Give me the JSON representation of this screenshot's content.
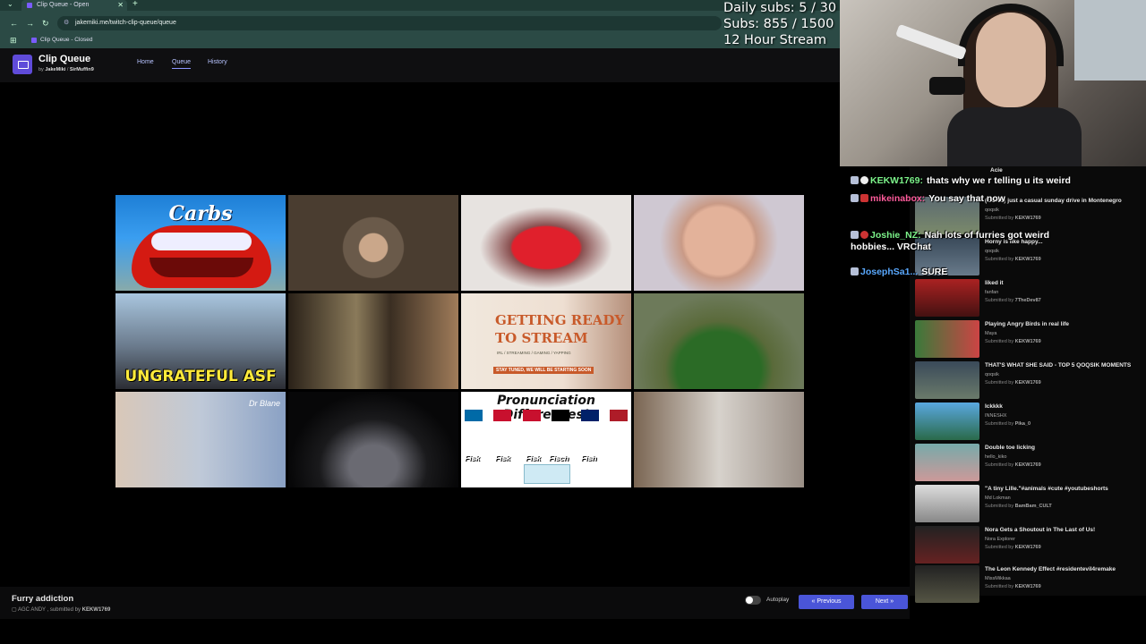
{
  "browser": {
    "tab_title": "Clip Queue - Open",
    "url": "jakemiki.me/twitch-clip-queue/queue",
    "bookmark": "Clip Queue - Closed"
  },
  "app": {
    "title": "Clip Queue",
    "by_prefix": "by",
    "author1": "JakeMiki",
    "author_sep": "/",
    "author2": "SirMuffin9",
    "nav": [
      "Home",
      "Queue",
      "History"
    ]
  },
  "player": {
    "cells": [
      {
        "caption": "Carbs"
      },
      {
        "caption": ""
      },
      {
        "caption": ""
      },
      {
        "caption": ""
      },
      {
        "caption": "UNGRATEFUL ASF"
      },
      {
        "caption": ""
      },
      {
        "caption": "GETTING READY TO STREAM",
        "sub": "IRL / STREAMING / GAMING / YAPPING",
        "stay": "STAY TUNED, WE WILL BE STARTING SOON"
      },
      {
        "caption": ""
      },
      {
        "caption": "",
        "brand": "Dr Blane"
      },
      {
        "caption": ""
      },
      {
        "caption": "Pronunciation Differences!",
        "words": [
          "Fisk",
          "Fisk",
          "Fisk",
          "Fisch",
          "Fish"
        ]
      },
      {
        "caption": ""
      }
    ],
    "flag_colors": [
      "#006aa7",
      "#c8102e",
      "#c8102e",
      "#000000",
      "#012169",
      "#ae1c28"
    ]
  },
  "current_clip": {
    "title": "Furry addiction",
    "channel": "AGC ANDY",
    "submitted_prefix": ", submitted by",
    "submitter": "KEKW1769"
  },
  "controls": {
    "autoplay_label": "Autoplay",
    "previous_label": "Previous",
    "next_label": "Next"
  },
  "overlay": {
    "daily_subs": "Daily subs: 5 / 30",
    "subs": "Subs: 855 / 1500",
    "stream": "12 Hour Stream"
  },
  "chat": [
    {
      "user": "KEKW1769:",
      "text": "thats why we r telling u its weird",
      "color": "#7cf38a"
    },
    {
      "user": "mikeinabox:",
      "text": "You say that now",
      "color": "#ff5b9b"
    },
    {
      "user": "Joshie_NZ:",
      "text": "Nah lots of furries got weird hobbies... VRChat",
      "color": "#7cf38a"
    },
    {
      "user": "JosephSa1...",
      "text": "SURE",
      "color": "#5aa9ff"
    }
  ],
  "queue": [
    {
      "title": "Acie",
      "author": "",
      "submitter": ""
    },
    {
      "title": "(GONE) just a casual sunday drive in Montenegro",
      "author": "qoqsik",
      "submitter": "KEKW1769"
    },
    {
      "title": "Horny is like happy...",
      "author": "qoqsik",
      "submitter": "KEKW1769"
    },
    {
      "title": "liked it",
      "author": "fanfan",
      "submitter": "7TheDev87"
    },
    {
      "title": "Playing Angry Birds in real life",
      "author": "Maya",
      "submitter": "KEKW1769"
    },
    {
      "title": "THAT'S WHAT SHE SAID - TOP 5 QOQSIK MOMENTS",
      "author": "qoqsik",
      "submitter": "KEKW1769"
    },
    {
      "title": "Ickkkk",
      "author": "INNESHX",
      "submitter": "Pika_0"
    },
    {
      "title": "Double toe licking",
      "author": "hello_kiko",
      "submitter": "KEKW1769"
    },
    {
      "title": "\"A tiny Lille.\"#animals #cute #youtubeshorts",
      "author": "Md Lokman",
      "submitter": "BamBam_CULT"
    },
    {
      "title": "Nora Gets a Shoutout in The Last of Us!",
      "author": "Nora Explorer",
      "submitter": "KEKW1769"
    },
    {
      "title": "The Leon Kennedy Effect #residentevil4remake",
      "author": "MissMikkaa",
      "submitter": "KEKW1769"
    }
  ],
  "queue_submitted_label": "Submitted by"
}
